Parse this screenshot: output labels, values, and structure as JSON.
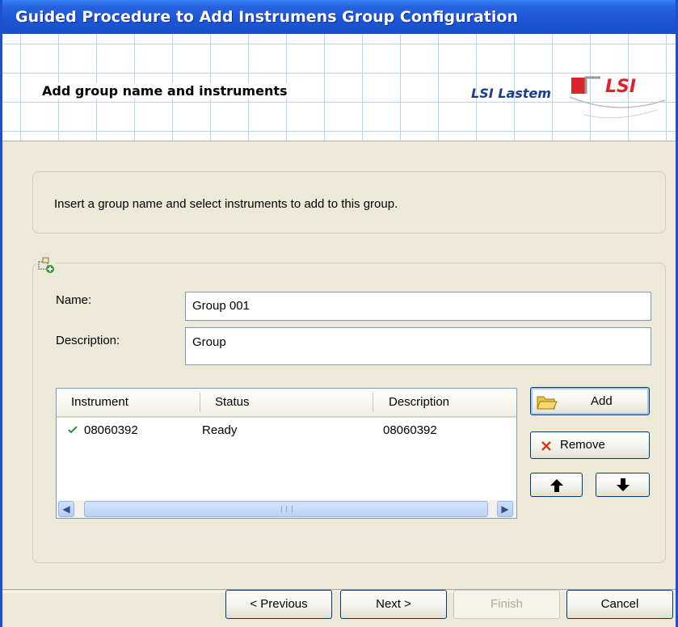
{
  "window": {
    "title": "Guided Procedure to Add Instrumens Group Configuration"
  },
  "header": {
    "title": "Add group name and instruments",
    "brand": "LSI Lastem",
    "logo_text": "LSI"
  },
  "info": {
    "text": "Insert a group name and select instruments to add to this group."
  },
  "form": {
    "name_label": "Name:",
    "name_value": "Group 001",
    "description_label": "Description:",
    "description_value": "Group"
  },
  "instruments": {
    "columns": [
      "Instrument",
      "Status",
      "Description"
    ],
    "rows": [
      {
        "instrument": "08060392",
        "status": "Ready",
        "description": "08060392",
        "status_icon": "check-icon"
      }
    ],
    "scrollbar": {
      "left_icon": "scroll-left-icon",
      "right_icon": "scroll-right-icon"
    }
  },
  "actions": {
    "add_label": "Add",
    "remove_label": "Remove",
    "up_icon": "arrow-up-icon",
    "down_icon": "arrow-down-icon"
  },
  "footer": {
    "previous_label": "< Previous",
    "next_label": "Next >",
    "finish_label": "Finish",
    "cancel_label": "Cancel"
  },
  "colors": {
    "titlebar": "#1c55d6",
    "brand_text": "#1a3d8f",
    "logo_red": "#d9262b",
    "check": "#2a9a2a",
    "remove_x": "#d23a1a"
  }
}
